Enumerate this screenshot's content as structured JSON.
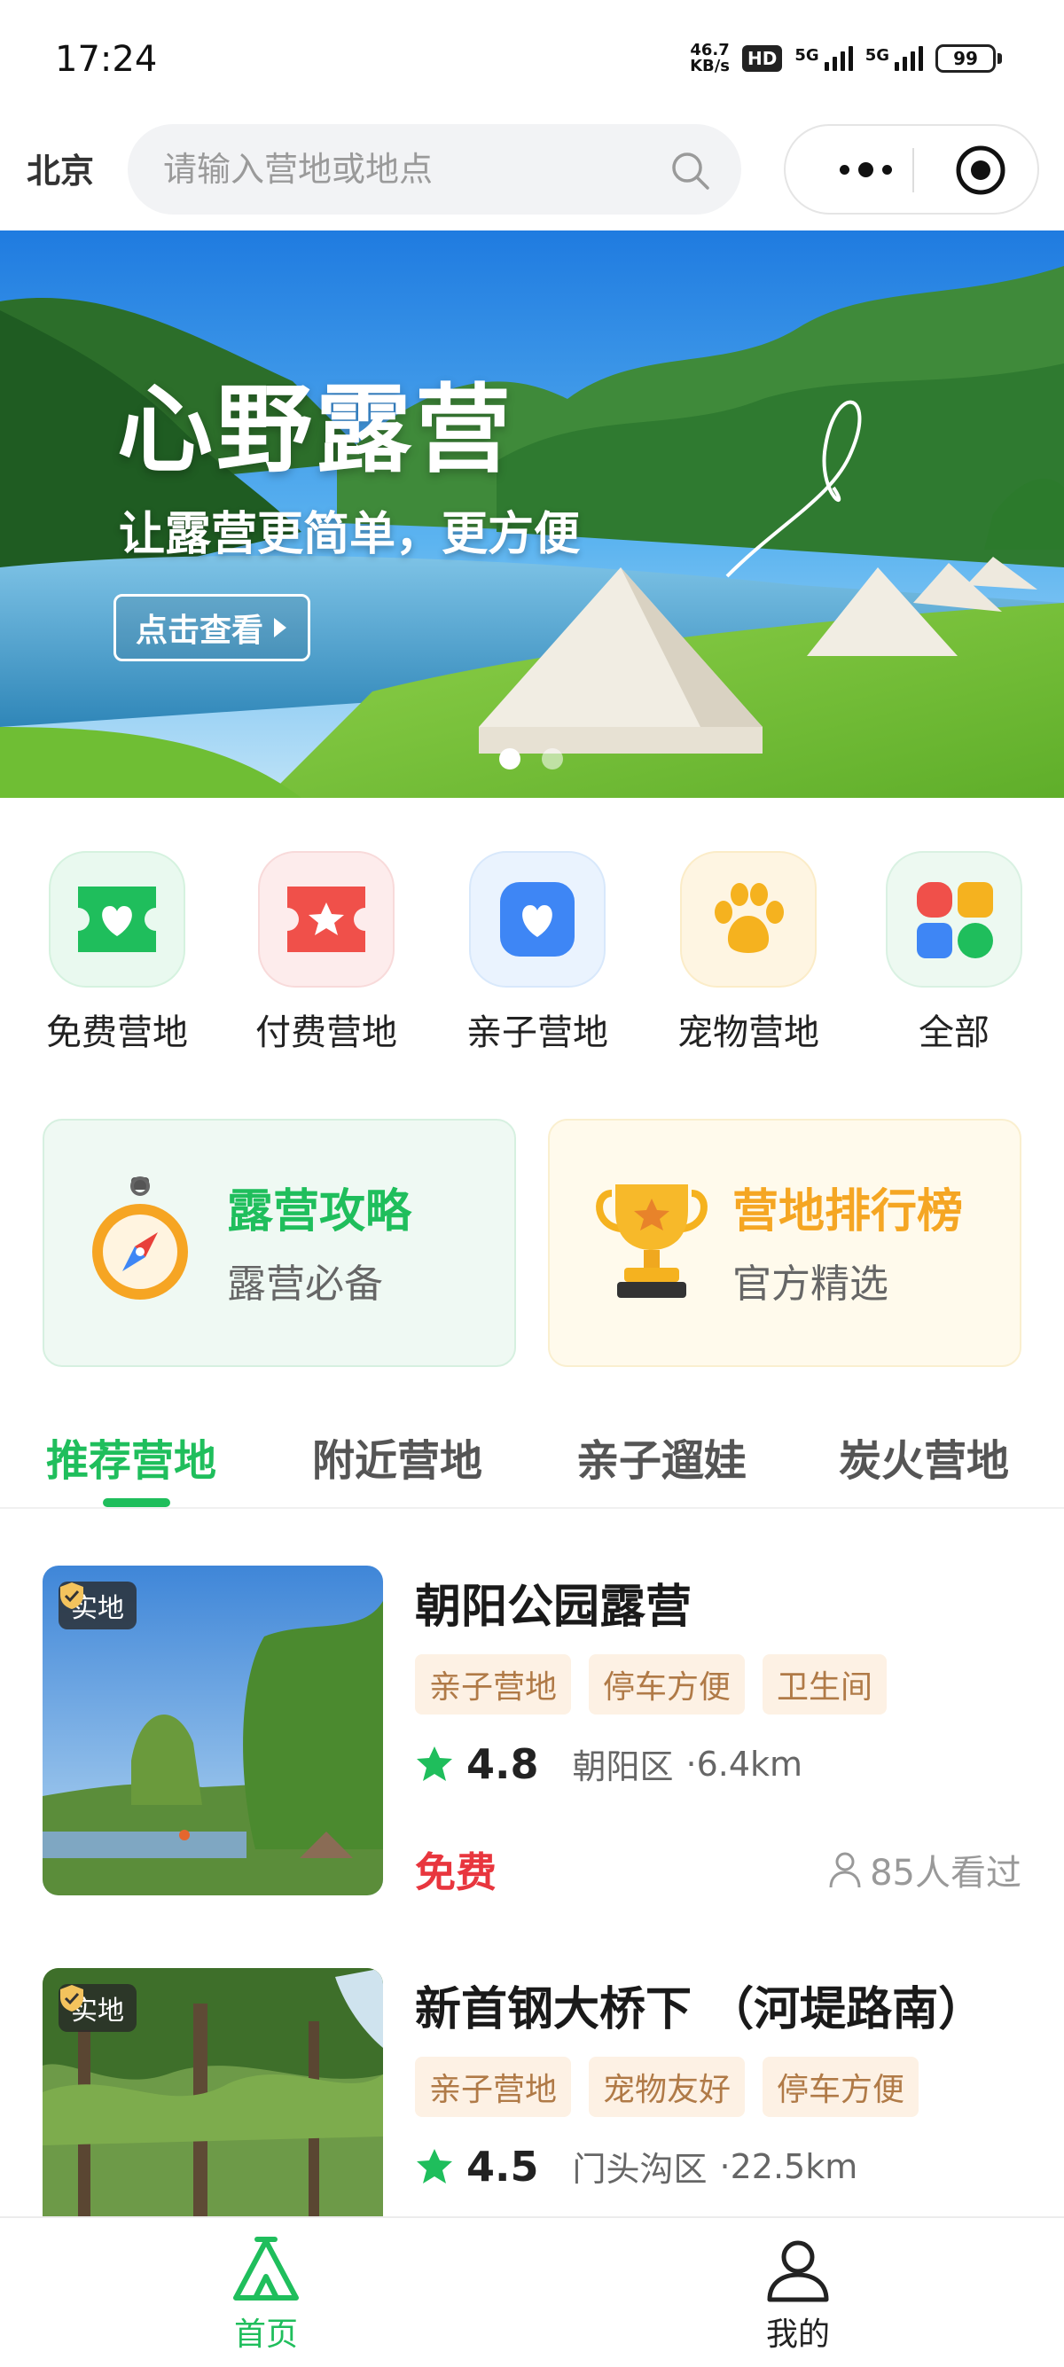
{
  "status_bar": {
    "time": "17:24",
    "net_speed_value": "46.7",
    "net_speed_unit": "KB/s",
    "hd": "HD",
    "signal1": "5G",
    "signal2": "5G",
    "battery": "99"
  },
  "header": {
    "city": "北京",
    "search_placeholder": "请输入营地或地点"
  },
  "banner": {
    "title": "心野露营",
    "subtitle": "让露营更简单，更方便",
    "button_label": "点击查看"
  },
  "categories": [
    {
      "label": "免费营地",
      "icon": "heart-ticket-icon",
      "color": "#1fbe5c"
    },
    {
      "label": "付费营地",
      "icon": "star-ticket-icon",
      "color": "#f0504a"
    },
    {
      "label": "亲子营地",
      "icon": "heart-shield-icon",
      "color": "#3e86f5"
    },
    {
      "label": "宠物营地",
      "icon": "paw-icon",
      "color": "#f5b21f"
    },
    {
      "label": "全部",
      "icon": "grid-icon",
      "color": "#1fbe5c"
    }
  ],
  "promos": [
    {
      "title": "露营攻略",
      "subtitle": "露营必备",
      "icon": "compass-icon",
      "title_color": "#1fbe5c"
    },
    {
      "title": "营地排行榜",
      "subtitle": "官方精选",
      "icon": "trophy-icon",
      "title_color": "#f5a623"
    }
  ],
  "tabs": [
    {
      "label": "推荐营地",
      "active": true
    },
    {
      "label": "附近营地",
      "active": false
    },
    {
      "label": "亲子遛娃",
      "active": false
    },
    {
      "label": "炭火营地",
      "active": false
    }
  ],
  "camps": [
    {
      "badge": "实地",
      "name": "朝阳公园露营",
      "tags": [
        "亲子营地",
        "停车方便",
        "卫生间"
      ],
      "rating": "4.8",
      "district": "朝阳区",
      "distance": "·6.4km",
      "price": "免费",
      "views": "85人看过"
    },
    {
      "badge": "实地",
      "name": "新首钢大桥下 （河堤路南）",
      "tags": [
        "亲子营地",
        "宠物友好",
        "停车方便"
      ],
      "rating": "4.5",
      "district": "门头沟区",
      "distance": "·22.5km"
    }
  ],
  "bottom_nav": [
    {
      "label": "首页",
      "icon": "tent-icon",
      "active": true
    },
    {
      "label": "我的",
      "icon": "user-icon",
      "active": false
    }
  ],
  "colors": {
    "accent": "#1fbe5c",
    "price": "#e8363e",
    "tag_bg": "#fdf1e4",
    "tag_text": "#b07a47"
  }
}
